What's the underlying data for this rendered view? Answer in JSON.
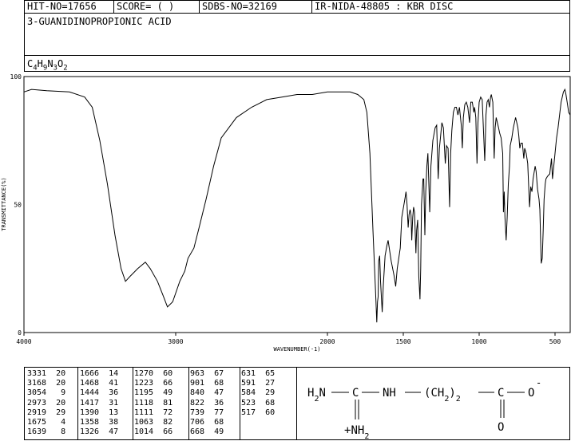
{
  "header": {
    "hit_no": "HIT-NO=17656",
    "score": "SCORE=  (   )",
    "sdbs_no": "SDBS-NO=32169",
    "ir_info": "IR-NIDA-48805 : KBR DISC"
  },
  "compound_name": "3-GUANIDINOPROPIONIC ACID",
  "formula": "C4H9N3O2",
  "chart_data": {
    "type": "line",
    "xlabel": "WAVENUMBER(-1)",
    "ylabel": "TRANSMITTANCE(%)",
    "xlim": [
      4000,
      400
    ],
    "ylim": [
      0,
      100
    ],
    "xticks": [
      4000,
      3000,
      2000,
      1500,
      1000,
      500
    ],
    "yticks": [
      0,
      50,
      100
    ],
    "grid": false,
    "series": [
      {
        "points": [
          [
            4000,
            94
          ],
          [
            3950,
            95
          ],
          [
            3850,
            94.5
          ],
          [
            3700,
            94
          ],
          [
            3600,
            92
          ],
          [
            3550,
            88
          ],
          [
            3500,
            75
          ],
          [
            3450,
            58
          ],
          [
            3400,
            38
          ],
          [
            3360,
            25
          ],
          [
            3331,
            20
          ],
          [
            3300,
            22
          ],
          [
            3250,
            25
          ],
          [
            3200,
            27.5
          ],
          [
            3168,
            25
          ],
          [
            3120,
            20
          ],
          [
            3080,
            14
          ],
          [
            3054,
            10
          ],
          [
            3020,
            12
          ],
          [
            2973,
            20
          ],
          [
            2940,
            24
          ],
          [
            2919,
            29
          ],
          [
            2880,
            33
          ],
          [
            2850,
            40
          ],
          [
            2800,
            52
          ],
          [
            2750,
            65
          ],
          [
            2700,
            76
          ],
          [
            2600,
            84
          ],
          [
            2500,
            88
          ],
          [
            2400,
            91
          ],
          [
            2300,
            92
          ],
          [
            2200,
            93
          ],
          [
            2100,
            93
          ],
          [
            2000,
            94
          ],
          [
            1900,
            94
          ],
          [
            1850,
            94
          ],
          [
            1800,
            93
          ],
          [
            1760,
            91
          ],
          [
            1740,
            86
          ],
          [
            1720,
            70
          ],
          [
            1700,
            40
          ],
          [
            1680,
            12
          ],
          [
            1675,
            4
          ],
          [
            1670,
            12
          ],
          [
            1666,
            14
          ],
          [
            1662,
            28
          ],
          [
            1656,
            30
          ],
          [
            1650,
            20
          ],
          [
            1639,
            8
          ],
          [
            1632,
            18
          ],
          [
            1620,
            30
          ],
          [
            1608,
            34
          ],
          [
            1600,
            36
          ],
          [
            1590,
            32
          ],
          [
            1580,
            28
          ],
          [
            1560,
            22
          ],
          [
            1550,
            18
          ],
          [
            1540,
            25
          ],
          [
            1520,
            33
          ],
          [
            1510,
            45
          ],
          [
            1490,
            52
          ],
          [
            1482,
            55
          ],
          [
            1475,
            50
          ],
          [
            1468,
            41
          ],
          [
            1462,
            46
          ],
          [
            1455,
            48
          ],
          [
            1449,
            46
          ],
          [
            1444,
            36
          ],
          [
            1438,
            45
          ],
          [
            1432,
            49
          ],
          [
            1426,
            47
          ],
          [
            1417,
            31
          ],
          [
            1412,
            40
          ],
          [
            1405,
            44
          ],
          [
            1398,
            22
          ],
          [
            1390,
            13
          ],
          [
            1385,
            25
          ],
          [
            1380,
            50
          ],
          [
            1370,
            60
          ],
          [
            1365,
            60
          ],
          [
            1358,
            38
          ],
          [
            1352,
            55
          ],
          [
            1345,
            65
          ],
          [
            1338,
            70
          ],
          [
            1326,
            47
          ],
          [
            1318,
            65
          ],
          [
            1305,
            75
          ],
          [
            1290,
            80
          ],
          [
            1280,
            81
          ],
          [
            1270,
            60
          ],
          [
            1262,
            72
          ],
          [
            1255,
            76
          ],
          [
            1246,
            82
          ],
          [
            1236,
            80
          ],
          [
            1223,
            66
          ],
          [
            1215,
            73
          ],
          [
            1205,
            72
          ],
          [
            1195,
            49
          ],
          [
            1188,
            70
          ],
          [
            1180,
            79
          ],
          [
            1170,
            86
          ],
          [
            1160,
            88
          ],
          [
            1150,
            88
          ],
          [
            1140,
            85
          ],
          [
            1130,
            88
          ],
          [
            1118,
            81
          ],
          [
            1111,
            72
          ],
          [
            1104,
            84
          ],
          [
            1095,
            89
          ],
          [
            1085,
            90
          ],
          [
            1075,
            88
          ],
          [
            1063,
            82
          ],
          [
            1055,
            90
          ],
          [
            1045,
            90
          ],
          [
            1035,
            86
          ],
          [
            1030,
            88
          ],
          [
            1022,
            84
          ],
          [
            1014,
            66
          ],
          [
            1008,
            82
          ],
          [
            1000,
            90
          ],
          [
            990,
            92
          ],
          [
            980,
            91
          ],
          [
            963,
            67
          ],
          [
            955,
            85
          ],
          [
            948,
            90
          ],
          [
            940,
            91
          ],
          [
            932,
            88
          ],
          [
            925,
            92
          ],
          [
            920,
            93
          ],
          [
            910,
            90
          ],
          [
            901,
            68
          ],
          [
            895,
            80
          ],
          [
            888,
            84
          ],
          [
            880,
            82
          ],
          [
            872,
            80
          ],
          [
            865,
            78
          ],
          [
            855,
            76
          ],
          [
            845,
            70
          ],
          [
            840,
            47
          ],
          [
            835,
            55
          ],
          [
            830,
            45
          ],
          [
            822,
            36
          ],
          [
            815,
            45
          ],
          [
            808,
            58
          ],
          [
            800,
            65
          ],
          [
            795,
            73
          ],
          [
            785,
            76
          ],
          [
            775,
            80
          ],
          [
            760,
            84
          ],
          [
            752,
            82
          ],
          [
            745,
            80
          ],
          [
            739,
            77
          ],
          [
            732,
            72
          ],
          [
            725,
            74
          ],
          [
            715,
            74
          ],
          [
            706,
            68
          ],
          [
            700,
            72
          ],
          [
            690,
            70
          ],
          [
            680,
            66
          ],
          [
            668,
            49
          ],
          [
            660,
            57
          ],
          [
            652,
            55
          ],
          [
            645,
            60
          ],
          [
            631,
            65
          ],
          [
            625,
            63
          ],
          [
            615,
            56
          ],
          [
            605,
            52
          ],
          [
            600,
            48
          ],
          [
            591,
            27
          ],
          [
            584,
            29
          ],
          [
            578,
            40
          ],
          [
            572,
            52
          ],
          [
            565,
            58
          ],
          [
            560,
            60
          ],
          [
            550,
            61
          ],
          [
            535,
            62
          ],
          [
            523,
            68
          ],
          [
            517,
            60
          ],
          [
            510,
            64
          ],
          [
            500,
            70
          ],
          [
            490,
            76
          ],
          [
            480,
            80
          ],
          [
            470,
            85
          ],
          [
            460,
            90
          ],
          [
            445,
            94
          ],
          [
            435,
            95
          ],
          [
            428,
            93
          ],
          [
            420,
            90
          ],
          [
            410,
            86
          ],
          [
            400,
            85
          ]
        ]
      }
    ]
  },
  "peak_table": [
    [
      "3331",
      "20",
      "1666",
      "14",
      "1270",
      "60",
      "963",
      "67",
      "631",
      "65"
    ],
    [
      "3168",
      "20",
      "1468",
      "41",
      "1223",
      "66",
      "901",
      "68",
      "591",
      "27"
    ],
    [
      "3054",
      "9",
      "1444",
      "36",
      "1195",
      "49",
      "840",
      "47",
      "584",
      "29"
    ],
    [
      "2973",
      "20",
      "1417",
      "31",
      "1118",
      "81",
      "822",
      "36",
      "523",
      "68"
    ],
    [
      "2919",
      "29",
      "1390",
      "13",
      "1111",
      "72",
      "739",
      "77",
      "517",
      "60"
    ],
    [
      "1675",
      "4",
      "1358",
      "38",
      "1063",
      "82",
      "706",
      "68",
      "",
      ""
    ],
    [
      "1639",
      "8",
      "1326",
      "47",
      "1014",
      "66",
      "668",
      "49",
      "",
      ""
    ]
  ],
  "structure": {
    "h2n": "H2N",
    "c1": "C",
    "nh": "NH",
    "ch2": "(CH2)2",
    "c2": "C",
    "o_minus": "O",
    "charge": "-",
    "nh2": "+NH2",
    "o": "O"
  }
}
